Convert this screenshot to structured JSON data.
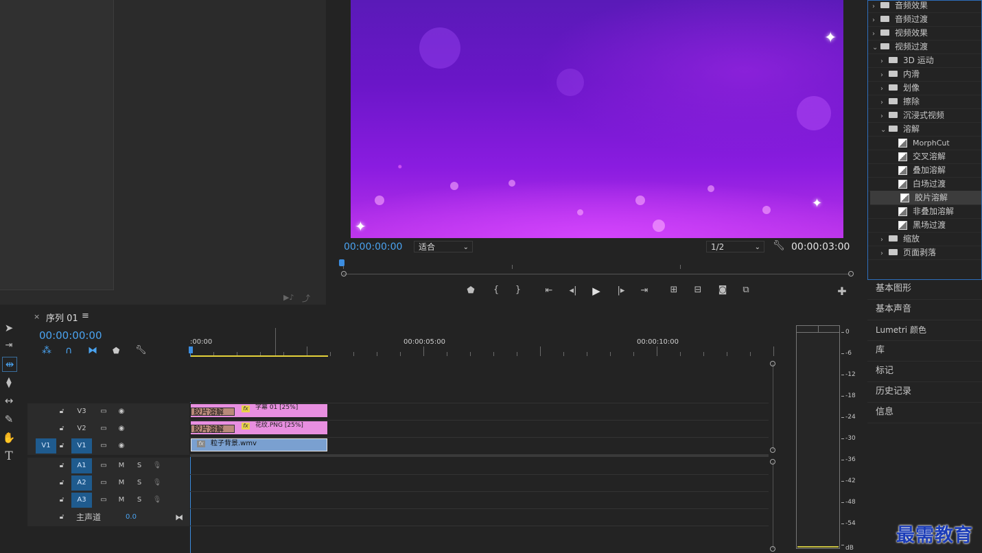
{
  "program_monitor": {
    "timecode_left": "00:00:00:00",
    "fit_label": "适合",
    "resolution": "1/2",
    "timecode_right": "00:00:03:00"
  },
  "effects_tree": [
    {
      "label": "音频效果",
      "type": "folder",
      "expanded": false
    },
    {
      "label": "音频过渡",
      "type": "folder",
      "expanded": false
    },
    {
      "label": "视频效果",
      "type": "folder",
      "expanded": false
    },
    {
      "label": "视频过渡",
      "type": "folder",
      "expanded": true
    },
    {
      "label": "3D 运动",
      "type": "folder",
      "expanded": false
    },
    {
      "label": "内滑",
      "type": "folder",
      "expanded": false
    },
    {
      "label": "划像",
      "type": "folder",
      "expanded": false
    },
    {
      "label": "擦除",
      "type": "folder",
      "expanded": false
    },
    {
      "label": "沉浸式视频",
      "type": "folder",
      "expanded": false
    },
    {
      "label": "溶解",
      "type": "folder",
      "expanded": true
    },
    {
      "label": "MorphCut",
      "type": "effect"
    },
    {
      "label": "交叉溶解",
      "type": "effect"
    },
    {
      "label": "叠加溶解",
      "type": "effect"
    },
    {
      "label": "白场过渡",
      "type": "effect"
    },
    {
      "label": "胶片溶解",
      "type": "effect",
      "selected": true
    },
    {
      "label": "非叠加溶解",
      "type": "effect"
    },
    {
      "label": "黑场过渡",
      "type": "effect"
    },
    {
      "label": "缩放",
      "type": "folder",
      "expanded": false
    },
    {
      "label": "页面剥落",
      "type": "folder",
      "expanded": false
    }
  ],
  "right_panels": [
    "基本图形",
    "基本声音",
    "Lumetri 颜色",
    "库",
    "标记",
    "历史记录",
    "信息"
  ],
  "timeline": {
    "close": "×",
    "sequence_name": "序列 01",
    "menu": "≡",
    "timecode": "00:00:00:00",
    "ruler_labels": [
      ":00:00",
      "00:00:05:00",
      "00:00:10:00"
    ],
    "video_tracks": [
      {
        "name": "V3",
        "source": ""
      },
      {
        "name": "V2",
        "source": ""
      },
      {
        "name": "V1",
        "source": "V1"
      }
    ],
    "audio_tracks": [
      {
        "name": "A1",
        "m": "M",
        "s": "S"
      },
      {
        "name": "A2",
        "m": "M",
        "s": "S"
      },
      {
        "name": "A3",
        "m": "M",
        "s": "S"
      }
    ],
    "master": {
      "label": "主声道",
      "value": "0.0"
    },
    "clips": {
      "v3_transition": "胶片溶解",
      "v3_clip": "字幕 01 [25%]",
      "v2_transition": "胶片溶解",
      "v2_clip": "花纹.PNG [25%]",
      "v1_clip": "粒子背景.wmv"
    }
  },
  "meter": {
    "db_labels": [
      "0",
      "-6",
      "-12",
      "-18",
      "-24",
      "-30",
      "-36",
      "-42",
      "-48",
      "-54",
      "dB"
    ]
  },
  "watermark": "最需教育",
  "colors": {
    "accent_blue": "#4aa3f0",
    "clip_pink": "#e88fe0",
    "clip_blue": "#7aa0d0",
    "transition": "#b98a7a",
    "selection_border": "#2e6fbd"
  }
}
